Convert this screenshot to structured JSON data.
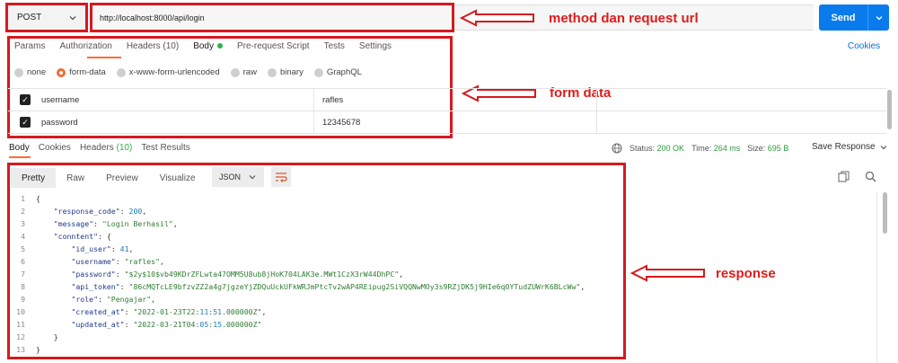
{
  "request": {
    "method": "POST",
    "url": "http://localhost:8000/api/login",
    "send_label": "Send"
  },
  "annotations": {
    "method_url": "method dan request url",
    "form_data": "form data",
    "response": "response"
  },
  "request_tabs": {
    "params": "Params",
    "authorization": "Authorization",
    "headers": "Headers (10)",
    "body": "Body",
    "prerequest": "Pre-request Script",
    "tests": "Tests",
    "settings": "Settings",
    "cookies": "Cookies"
  },
  "body_types": {
    "none": "none",
    "form_data": "form-data",
    "urlencoded": "x-www-form-urlencoded",
    "raw": "raw",
    "binary": "binary",
    "graphql": "GraphQL",
    "selected": "form-data"
  },
  "form_rows": [
    {
      "key": "username",
      "value": "rafles"
    },
    {
      "key": "password",
      "value": "12345678"
    }
  ],
  "response_tabs": {
    "body": "Body",
    "cookies": "Cookies",
    "headers_label": "Headers",
    "headers_count": "(10)",
    "test_results": "Test Results"
  },
  "response_status": {
    "status_label": "Status:",
    "status_value": "200 OK",
    "time_label": "Time:",
    "time_value": "264 ms",
    "size_label": "Size:",
    "size_value": "695 B",
    "save_label": "Save Response"
  },
  "response_view": {
    "pretty": "Pretty",
    "raw": "Raw",
    "preview": "Preview",
    "visualize": "Visualize",
    "format": "JSON"
  },
  "code_lines": [
    {
      "n": "1",
      "text": "{"
    },
    {
      "n": "2",
      "text": "    \"response_code\": 200,"
    },
    {
      "n": "3",
      "text": "    \"message\": \"Login Berhasil\","
    },
    {
      "n": "4",
      "text": "    \"conntent\": {"
    },
    {
      "n": "5",
      "text": "        \"id_user\": 41,"
    },
    {
      "n": "6",
      "text": "        \"username\": \"rafles\","
    },
    {
      "n": "7",
      "text": "        \"password\": \"$2y$10$vb49KDrZFLwta47OMM5U8ub8jHoK704LAK3e.MWt1CzX3rW44DhPC\","
    },
    {
      "n": "8",
      "text": "        \"api_token\": \"86cMQTcLE9bfzvZZ2a4g7jgzeYjZDQuUckUFkWRJmPtcTv2wAP4REipug2SiVQQNwMOy3s9RZjDK5j9HIe6qOYTudZUWrK6BLcWw\","
    },
    {
      "n": "9",
      "text": "        \"role\": \"Pengajar\","
    },
    {
      "n": "10",
      "text": "        \"created_at\": \"2022-01-23T22:11:51.000000Z\","
    },
    {
      "n": "11",
      "text": "        \"updated_at\": \"2022-03-21T04:05:15.000000Z\""
    },
    {
      "n": "12",
      "text": "    }"
    },
    {
      "n": "13",
      "text": "}"
    }
  ],
  "colors": {
    "send": "#097bed",
    "annotation": "#d6191f",
    "status_ok": "#2d9a3c"
  }
}
